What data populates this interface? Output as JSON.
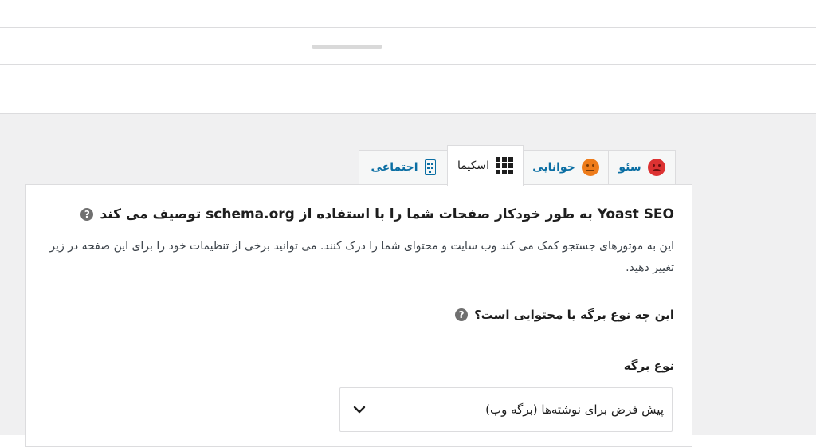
{
  "tabs": [
    {
      "label": "سئو",
      "icon": "sad-face-icon",
      "color": "#dc3232"
    },
    {
      "label": "خوانایی",
      "icon": "neutral-face-icon",
      "color": "#ee7c1b"
    },
    {
      "label": "اسکیما",
      "icon": "grid-icon",
      "active": true
    },
    {
      "label": "اجتماعی",
      "icon": "share-icon"
    }
  ],
  "schema_panel": {
    "heading": "Yoast SEO به طور خودکار صفحات شما را با استفاده از schema.org توصیف می کند",
    "description": "این به موتورهای جستجو کمک می کند وب سایت و محتوای شما را درک کنند. می توانید برخی از تنظیمات خود را برای این صفحه در زیر تغییر دهید.",
    "question": "این چه نوع برگه یا محتوایی است؟",
    "page_type_label": "نوع برگه",
    "page_type_value": "پیش فرض برای نوشته‌ها (برگه وب)"
  },
  "colors": {
    "accent": "#0a6ea3",
    "background": "#f0f0f1",
    "border": "#dcdcde"
  }
}
